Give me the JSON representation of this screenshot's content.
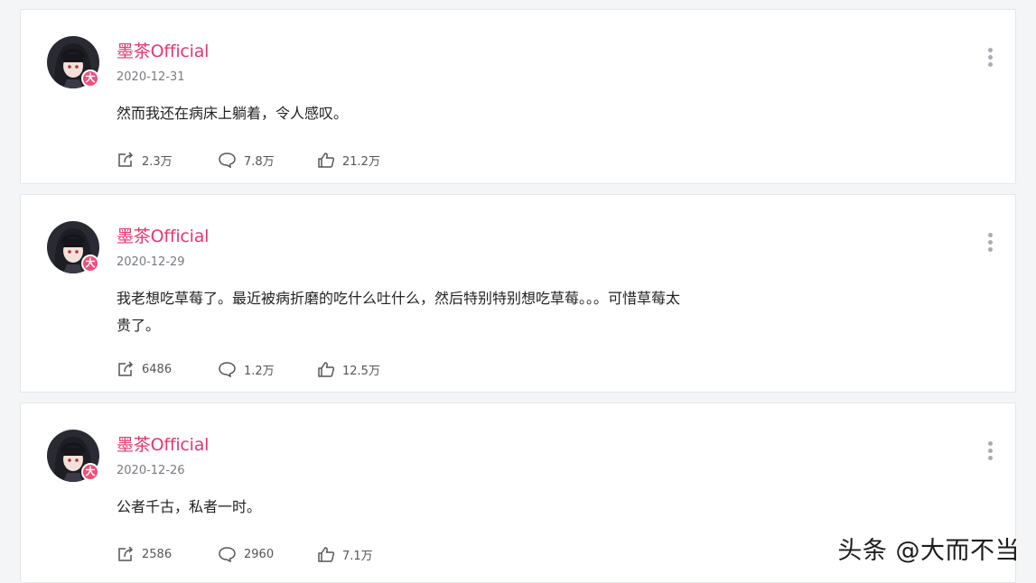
{
  "posts": [
    {
      "author": "墨茶Official",
      "badge": "大",
      "date": "2020-12-31",
      "content": "然而我还在病床上躺着，令人感叹。",
      "share_count": "2.3万",
      "comment_count": "7.8万",
      "like_count": "21.2万"
    },
    {
      "author": "墨茶Official",
      "badge": "大",
      "date": "2020-12-29",
      "content": "我老想吃草莓了。最近被病折磨的吃什么吐什么，然后特别特别想吃草莓。。。可惜草莓太贵了。",
      "share_count": "6486",
      "comment_count": "1.2万",
      "like_count": "12.5万"
    },
    {
      "author": "墨茶Official",
      "badge": "大",
      "date": "2020-12-26",
      "content": "公者千古，私者一时。",
      "share_count": "2586",
      "comment_count": "2960",
      "like_count": "7.1万"
    }
  ],
  "watermark": "头条 @大而不当",
  "colors": {
    "author": "#e8356d",
    "badge": "#f04e7c"
  }
}
